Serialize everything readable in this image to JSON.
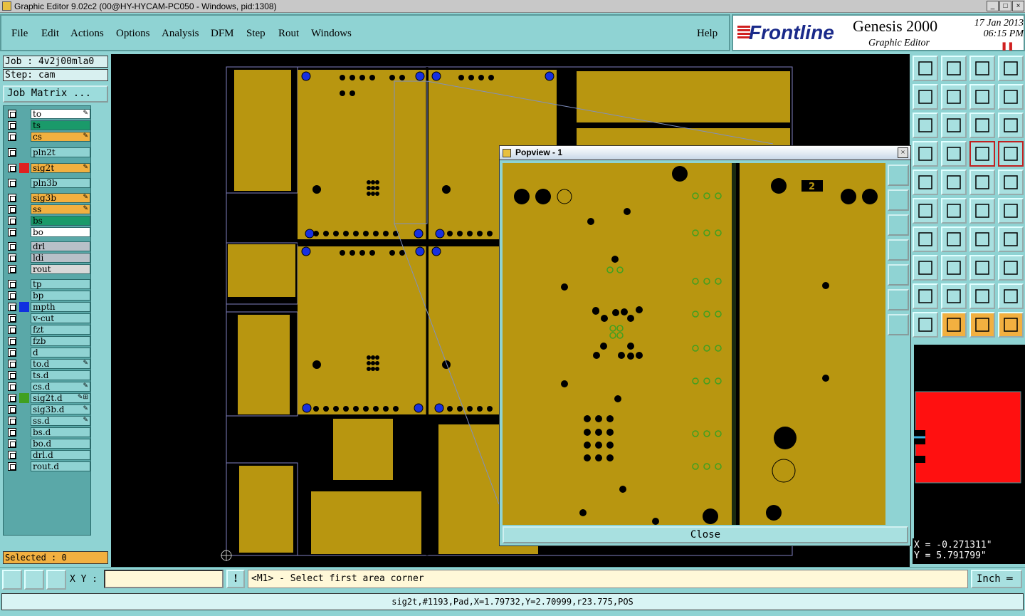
{
  "window": {
    "title": "Graphic Editor 9.02c2 (00@HY-HYCAM-PC050 - Windows, pid:1308)"
  },
  "menu": {
    "items": [
      "File",
      "Edit",
      "Actions",
      "Options",
      "Analysis",
      "DFM",
      "Step",
      "Rout",
      "Windows"
    ],
    "help": "Help"
  },
  "logo": {
    "brand": "Frontline",
    "product": "Genesis 2000",
    "subtitle": "Graphic Editor",
    "date": "17 Jan 2013",
    "time": "06:15 PM"
  },
  "job": {
    "job_label": "Job : 4v2j00mla0",
    "step_label": "Step: cam",
    "matrix_button": "Job Matrix ..."
  },
  "layers": [
    {
      "name": "to",
      "bg": "#ffffff",
      "color": "",
      "flag": "✎"
    },
    {
      "name": "ts",
      "bg": "#1a9a6a",
      "color": "",
      "flag": ""
    },
    {
      "name": "cs",
      "bg": "#f2b040",
      "color": "",
      "flag": "✎"
    },
    {
      "name": "pln2t",
      "bg": "#8fd3d3",
      "color": "",
      "flag": ""
    },
    {
      "name": "sig2t",
      "bg": "#f2b040",
      "color": "#e02020",
      "flag": "✎"
    },
    {
      "name": "pln3b",
      "bg": "#8fd3d3",
      "color": "",
      "flag": ""
    },
    {
      "name": "sig3b",
      "bg": "#f2b040",
      "color": "",
      "flag": "✎"
    },
    {
      "name": "ss",
      "bg": "#f2b040",
      "color": "",
      "flag": "✎"
    },
    {
      "name": "bs",
      "bg": "#1a9a6a",
      "color": "",
      "flag": ""
    },
    {
      "name": "bo",
      "bg": "#ffffff",
      "color": "",
      "flag": ""
    },
    {
      "name": "drl",
      "bg": "#b8c0c8",
      "color": "",
      "flag": ""
    },
    {
      "name": "ldi",
      "bg": "#b8c0c8",
      "color": "",
      "flag": ""
    },
    {
      "name": "rout",
      "bg": "#d8d8d8",
      "color": "",
      "flag": ""
    },
    {
      "name": "tp",
      "bg": "#8fd3d3",
      "color": "",
      "flag": ""
    },
    {
      "name": "bp",
      "bg": "#8fd3d3",
      "color": "",
      "flag": ""
    },
    {
      "name": "mpth",
      "bg": "#8fd3d3",
      "color": "#1030e0",
      "flag": ""
    },
    {
      "name": "v-cut",
      "bg": "#8fd3d3",
      "color": "",
      "flag": ""
    },
    {
      "name": "fzt",
      "bg": "#8fd3d3",
      "color": "",
      "flag": ""
    },
    {
      "name": "fzb",
      "bg": "#8fd3d3",
      "color": "",
      "flag": ""
    },
    {
      "name": "d",
      "bg": "#8fd3d3",
      "color": "",
      "flag": ""
    },
    {
      "name": "to.d",
      "bg": "#8fd3d3",
      "color": "",
      "flag": "✎"
    },
    {
      "name": "ts.d",
      "bg": "#8fd3d3",
      "color": "",
      "flag": ""
    },
    {
      "name": "cs.d",
      "bg": "#8fd3d3",
      "color": "",
      "flag": "✎"
    },
    {
      "name": "sig2t.d",
      "bg": "#8fd3d3",
      "color": "#40a020",
      "flag": "✎⊞"
    },
    {
      "name": "sig3b.d",
      "bg": "#8fd3d3",
      "color": "",
      "flag": "✎"
    },
    {
      "name": "ss.d",
      "bg": "#8fd3d3",
      "color": "",
      "flag": "✎"
    },
    {
      "name": "bs.d",
      "bg": "#8fd3d3",
      "color": "",
      "flag": ""
    },
    {
      "name": "bo.d",
      "bg": "#8fd3d3",
      "color": "",
      "flag": ""
    },
    {
      "name": "drl.d",
      "bg": "#8fd3d3",
      "color": "",
      "flag": ""
    },
    {
      "name": "rout.d",
      "bg": "#8fd3d3",
      "color": "",
      "flag": ""
    }
  ],
  "selected": "Selected : 0",
  "popview": {
    "title": "Popview - 1",
    "close": "Close",
    "label_2": "2"
  },
  "coords": {
    "x": "X = -0.271311\"",
    "y": "Y = 5.791799\""
  },
  "bottom": {
    "xy_label": "X Y :",
    "xy_value": "",
    "prompt": "<M1> - Select first area corner",
    "units": "Inch",
    "status": "sig2t,#1193,Pad,X=1.79732,Y=2.70999,r23.775,POS"
  },
  "colors": {
    "copper": "#b89610",
    "board_bg": "#000000",
    "ui_teal": "#8fd3d3",
    "highlight_orange": "#f2b040",
    "minimap_red": "#ff1010"
  }
}
